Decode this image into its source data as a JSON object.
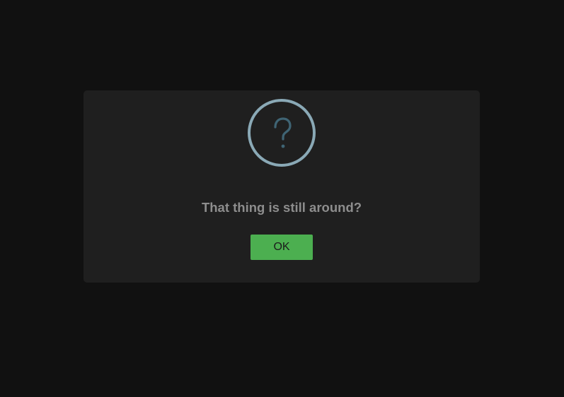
{
  "dialog": {
    "icon": "question-icon",
    "icon_glyph": "?",
    "title": "That thing is still around?",
    "confirm_label": "OK"
  },
  "colors": {
    "background": "#111111",
    "dialog_background": "#1f1f1f",
    "icon_ring": "#8aa9b6",
    "icon_glyph": "#3f6474",
    "title_text": "#8d8d8d",
    "confirm_button": "#4caf50"
  }
}
